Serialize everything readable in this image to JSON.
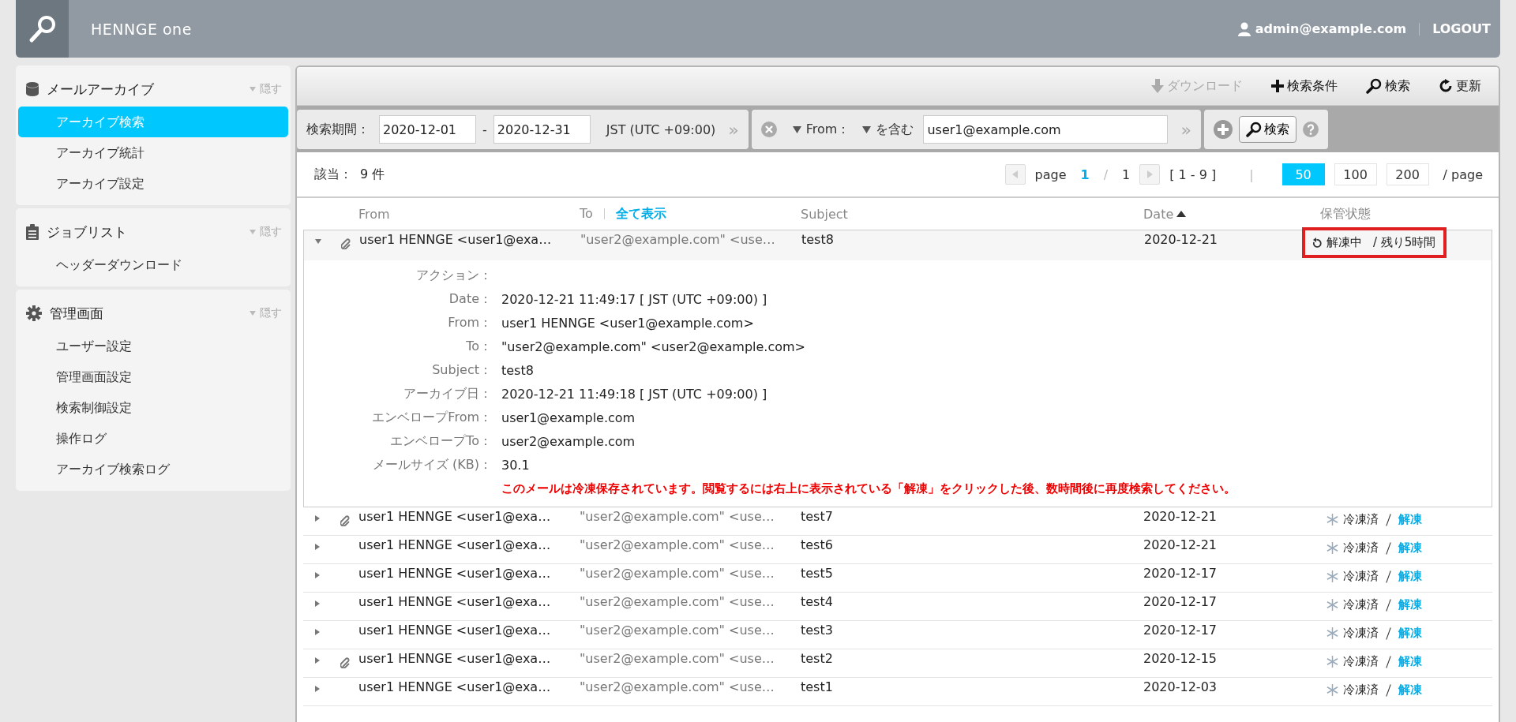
{
  "header": {
    "brand": "HENNGE one",
    "user": "admin@example.com",
    "logout": "LOGOUT"
  },
  "sidebar": [
    {
      "kind": "database",
      "title": "メールアーカイブ",
      "hide": "隠す",
      "items": [
        {
          "label": "アーカイブ検索",
          "selected": true
        },
        {
          "label": "アーカイブ統計",
          "selected": false
        },
        {
          "label": "アーカイブ設定",
          "selected": false
        }
      ]
    },
    {
      "kind": "clipboard",
      "title": "ジョブリスト",
      "hide": "隠す",
      "items": [
        {
          "label": "ヘッダーダウンロード",
          "selected": false
        }
      ]
    },
    {
      "kind": "gear",
      "title": "管理画面",
      "hide": "隠す",
      "items": [
        {
          "label": "ユーザー設定",
          "selected": false
        },
        {
          "label": "管理画面設定",
          "selected": false
        },
        {
          "label": "検索制御設定",
          "selected": false
        },
        {
          "label": "操作ログ",
          "selected": false
        },
        {
          "label": "アーカイブ検索ログ",
          "selected": false
        }
      ]
    }
  ],
  "toolbar": [
    {
      "kind": "download",
      "label": "ダウンロード",
      "disabled": true
    },
    {
      "kind": "add",
      "label": "検索条件",
      "disabled": false
    },
    {
      "kind": "search",
      "label": "検索",
      "disabled": false
    },
    {
      "kind": "refresh",
      "label": "更新",
      "disabled": false
    }
  ],
  "filter": {
    "period_label": "検索期間：",
    "from": "2020-12-01",
    "dash": "-",
    "to": "2020-12-31",
    "timezone": "JST (UTC +09:00)",
    "more": "»",
    "field": "From：",
    "operator": "を含む",
    "value": "user1@example.com",
    "more2": "»",
    "search": "検索"
  },
  "summary": {
    "label": "該当：",
    "count": "9 件"
  },
  "pager": {
    "page_label": "page",
    "current": "1",
    "slash": "/",
    "total": "1",
    "range": "[ 1 - 9 ]",
    "divider": "|",
    "per_page": [
      {
        "label": "50",
        "selected": true
      },
      {
        "label": "100",
        "selected": false
      },
      {
        "label": "200",
        "selected": false
      }
    ],
    "per_page_suffix": "/ page"
  },
  "columns": {
    "from": "From",
    "to": "To",
    "show_all": "全て表示",
    "subject": "Subject",
    "date": "Date",
    "date_sorted": true,
    "status": "保管状態"
  },
  "rows": [
    {
      "expanded": true,
      "attachment": true,
      "from": "user1 HENNGE <user1@exa…",
      "to": "\"user2@example.com\" <use…",
      "subject": "test8",
      "date": "2020-12-21",
      "status": {
        "kind": "thawing",
        "label": "解凍中",
        "action": "/ 残り5時間",
        "highlighted": true
      },
      "details": [
        {
          "label": "アクション："
        },
        {
          "label": "Date：",
          "value": "2020-12-21 11:49:17 [ JST (UTC +09:00) ]"
        },
        {
          "label": "From：",
          "value": "user1 HENNGE <user1@example.com>"
        },
        {
          "label": "To：",
          "value": "\"user2@example.com\" <user2@example.com>"
        },
        {
          "label": "Subject：",
          "value": "test8"
        },
        {
          "label": "アーカイブ日：",
          "value": "2020-12-21 11:49:18 [ JST (UTC +09:00) ]"
        },
        {
          "label": "エンベロープFrom：",
          "value": "user1@example.com"
        },
        {
          "label": "エンベロープTo：",
          "value": "user2@example.com"
        },
        {
          "label": "メールサイズ (KB)：",
          "value": "30.1"
        }
      ],
      "notice": "このメールは冷凍保存されています。閲覧するには右上に表示されている「解凍」をクリックした後、数時間後に再度検索してください。"
    },
    {
      "expanded": false,
      "attachment": true,
      "from": "user1 HENNGE <user1@exa…",
      "to": "\"user2@example.com\" <use…",
      "subject": "test7",
      "date": "2020-12-21",
      "status": {
        "kind": "frozen",
        "label": "冷凍済",
        "action": "解凍",
        "highlighted": false
      }
    },
    {
      "expanded": false,
      "attachment": false,
      "from": "user1 HENNGE <user1@exa…",
      "to": "\"user2@example.com\" <use…",
      "subject": "test6",
      "date": "2020-12-21",
      "status": {
        "kind": "frozen",
        "label": "冷凍済",
        "action": "解凍",
        "highlighted": false
      }
    },
    {
      "expanded": false,
      "attachment": false,
      "from": "user1 HENNGE <user1@exa…",
      "to": "\"user2@example.com\" <use…",
      "subject": "test5",
      "date": "2020-12-17",
      "status": {
        "kind": "frozen",
        "label": "冷凍済",
        "action": "解凍",
        "highlighted": false
      }
    },
    {
      "expanded": false,
      "attachment": false,
      "from": "user1 HENNGE <user1@exa…",
      "to": "\"user2@example.com\" <use…",
      "subject": "test4",
      "date": "2020-12-17",
      "status": {
        "kind": "frozen",
        "label": "冷凍済",
        "action": "解凍",
        "highlighted": false
      }
    },
    {
      "expanded": false,
      "attachment": false,
      "from": "user1 HENNGE <user1@exa…",
      "to": "\"user2@example.com\" <use…",
      "subject": "test3",
      "date": "2020-12-17",
      "status": {
        "kind": "frozen",
        "label": "冷凍済",
        "action": "解凍",
        "highlighted": false
      }
    },
    {
      "expanded": false,
      "attachment": true,
      "from": "user1 HENNGE <user1@exa…",
      "to": "\"user2@example.com\" <use…",
      "subject": "test2",
      "date": "2020-12-15",
      "status": {
        "kind": "frozen",
        "label": "冷凍済",
        "action": "解凍",
        "highlighted": false
      }
    },
    {
      "expanded": false,
      "attachment": false,
      "from": "user1 HENNGE <user1@exa…",
      "to": "\"user2@example.com\" <use…",
      "subject": "test1",
      "date": "2020-12-03",
      "status": {
        "kind": "frozen",
        "label": "冷凍済",
        "action": "解凍",
        "highlighted": false
      }
    }
  ]
}
